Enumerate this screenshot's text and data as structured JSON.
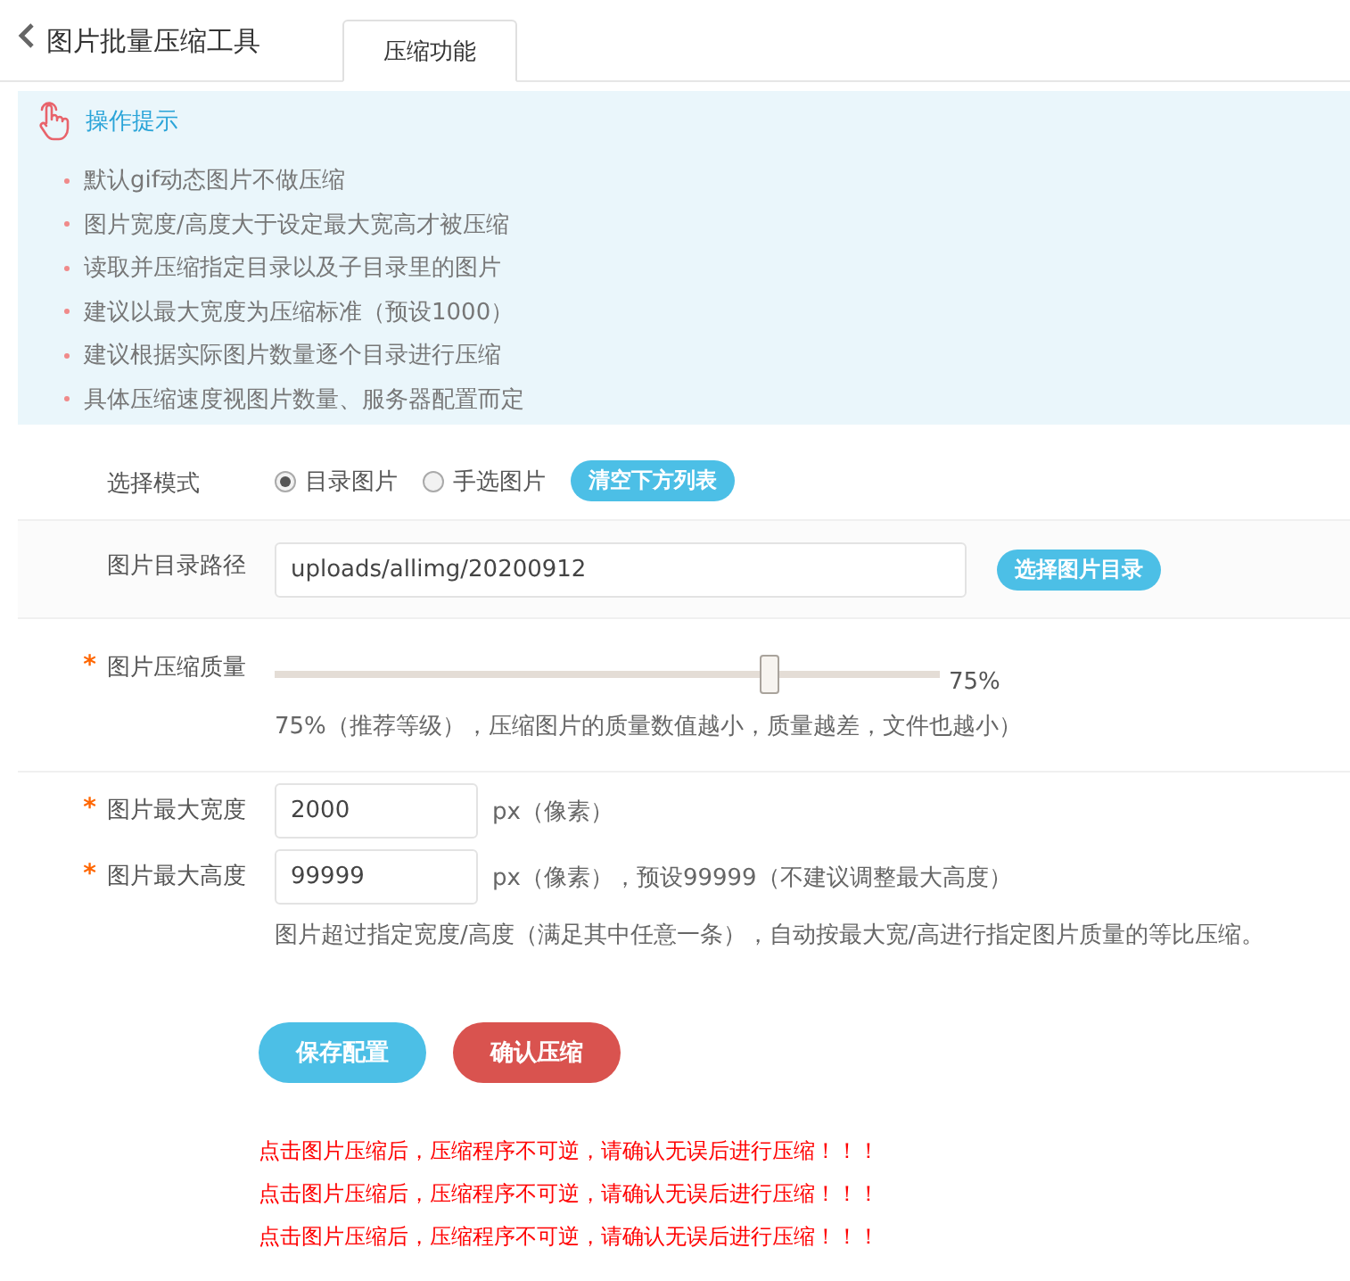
{
  "header": {
    "title": "图片批量压缩工具",
    "tabs": [
      {
        "label": "压缩功能",
        "selected": true
      }
    ]
  },
  "tips": {
    "title": "操作提示",
    "items": [
      "默认gif动态图片不做压缩",
      "图片宽度/高度大于设定最大宽高才被压缩",
      "读取并压缩指定目录以及子目录里的图片",
      "建议以最大宽度为压缩标准（预设1000）",
      "建议根据实际图片数量逐个目录进行压缩",
      "具体压缩速度视图片数量、服务器配置而定"
    ]
  },
  "rows": [
    {
      "kind": "mode",
      "label": "选择模式",
      "options": [
        {
          "label": "目录图片",
          "selected": true
        },
        {
          "label": "手选图片",
          "selected": false
        }
      ],
      "button": "清空下方列表"
    },
    {
      "kind": "path",
      "label": "图片目录路径",
      "value": "uploads/allimg/20200912",
      "button": "选择图片目录"
    },
    {
      "kind": "slider",
      "label": "图片压缩质量",
      "required_mark": "*",
      "level": 0.75,
      "reading": "75%",
      "hint": "75%（推荐等级），压缩图片的质量数值越小，质量越差，文件也越小）"
    },
    {
      "kind": "size",
      "label": "图片最大宽度",
      "required_mark": "*",
      "value": "2000",
      "unit": "px（像素）"
    },
    {
      "kind": "size",
      "label": "图片最大高度",
      "required_mark": "*",
      "value": "99999",
      "unit": "px（像素），预设99999（不建议调整最大高度）",
      "hint": "图片超过指定宽度/高度（满足其中任意一条），自动按最大宽/高进行指定图片质量的等比压缩。"
    }
  ],
  "actions": [
    {
      "label": "保存配置",
      "kind": "primary"
    },
    {
      "label": "确认压缩",
      "kind": "danger"
    }
  ],
  "warnings": [
    "点击图片压缩后，压缩程序不可逆，请确认无误后进行压缩！！！",
    "点击图片压缩后，压缩程序不可逆，请确认无误后进行压缩！！！",
    "点击图片压缩后，压缩程序不可逆，请确认无误后进行压缩！！！"
  ]
}
